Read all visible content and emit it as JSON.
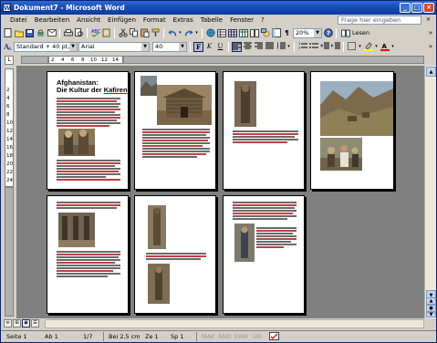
{
  "window": {
    "title": "Dokument7 - Microsoft Word"
  },
  "menu": {
    "items": [
      "Datei",
      "Bearbeiten",
      "Ansicht",
      "Einfügen",
      "Format",
      "Extras",
      "Tabelle",
      "Fenster",
      "?"
    ],
    "help_placeholder": "Frage hier eingeben",
    "close_glyph": "×"
  },
  "toolbar": {
    "zoom": "20%",
    "read_label": "Lesen",
    "pilcrow": "¶"
  },
  "format_toolbar": {
    "style": "Standard + 40 pt, F",
    "font": "Arial",
    "size": "40",
    "bold": "F",
    "italic": "K",
    "underline": "U"
  },
  "ruler": {
    "marks": [
      "2",
      "4",
      "6",
      "8",
      "10",
      "12",
      "14"
    ],
    "vertical_marks": [
      "2",
      "4",
      "6",
      "8",
      "10",
      "12",
      "14",
      "16",
      "18",
      "20",
      "22",
      "24"
    ]
  },
  "document": {
    "heading_line1": "Afghanistan:",
    "heading_line2_a": "Die Kultur der ",
    "heading_line2_b": "Kafiren"
  },
  "statusbar": {
    "page": "Seite 1",
    "section": "Ab 1",
    "pages": "1/7",
    "position": "Bei 2,5 cm",
    "line": "Ze 1",
    "column": "Sp 1",
    "mak": "MAK",
    "and": "ÄND",
    "erw": "ERW",
    "ub": "ÜB"
  },
  "icons": [
    "app-icon",
    "minimize-icon",
    "maximize-icon",
    "close-icon",
    "new-doc-icon",
    "open-icon",
    "save-icon",
    "print-icon",
    "preview-icon",
    "spellcheck-icon",
    "cut-icon",
    "copy-icon",
    "paste-icon",
    "undo-icon",
    "redo-icon",
    "hyperlink-icon",
    "table-icon",
    "columns-icon",
    "drawing-icon",
    "help-icon",
    "read-icon"
  ]
}
